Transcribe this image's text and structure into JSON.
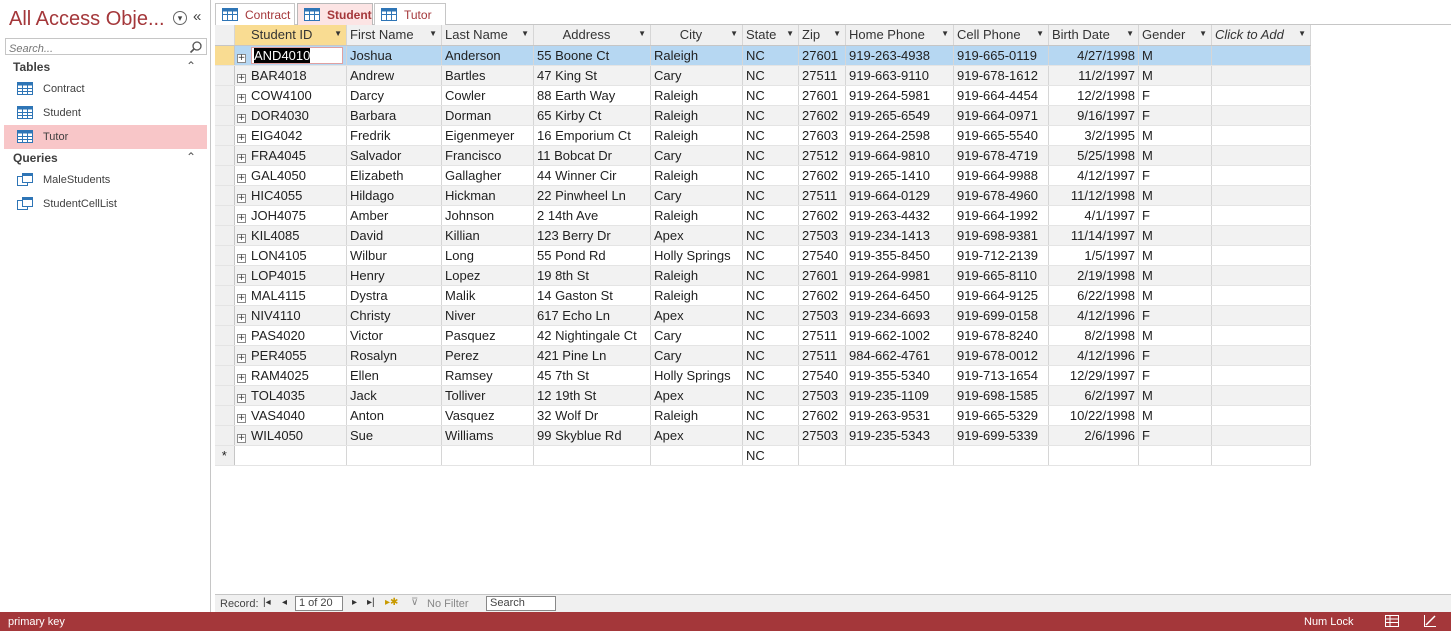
{
  "nav": {
    "title": "All Access Obje...",
    "search_placeholder": "Search...",
    "groups": [
      {
        "label": "Tables",
        "items": [
          {
            "label": "Contract",
            "icon": "table-icon"
          },
          {
            "label": "Student",
            "icon": "table-icon"
          },
          {
            "label": "Tutor",
            "icon": "table-icon",
            "selected": true
          }
        ]
      },
      {
        "label": "Queries",
        "items": [
          {
            "label": "MaleStudents",
            "icon": "query-icon"
          },
          {
            "label": "StudentCellList",
            "icon": "query-icon"
          }
        ]
      }
    ]
  },
  "tabs": [
    {
      "label": "Contract",
      "active": false
    },
    {
      "label": "Student",
      "active": true
    },
    {
      "label": "Tutor",
      "active": false
    }
  ],
  "table": {
    "columns": [
      "Student ID",
      "First Name",
      "Last Name",
      "Address",
      "City",
      "State",
      "Zip",
      "Home Phone",
      "Cell Phone",
      "Birth Date",
      "Gender",
      "Click to Add"
    ],
    "rows": [
      [
        "AND4010",
        "Joshua",
        "Anderson",
        "55 Boone Ct",
        "Raleigh",
        "NC",
        "27601",
        "919-263-4938",
        "919-665-0119",
        "4/27/1998",
        "M"
      ],
      [
        "BAR4018",
        "Andrew",
        "Bartles",
        "47 King St",
        "Cary",
        "NC",
        "27511",
        "919-663-9110",
        "919-678-1612",
        "11/2/1997",
        "M"
      ],
      [
        "COW4100",
        "Darcy",
        "Cowler",
        "88 Earth Way",
        "Raleigh",
        "NC",
        "27601",
        "919-264-5981",
        "919-664-4454",
        "12/2/1998",
        "F"
      ],
      [
        "DOR4030",
        "Barbara",
        "Dorman",
        "65 Kirby Ct",
        "Raleigh",
        "NC",
        "27602",
        "919-265-6549",
        "919-664-0971",
        "9/16/1997",
        "F"
      ],
      [
        "EIG4042",
        "Fredrik",
        "Eigenmeyer",
        "16 Emporium Ct",
        "Raleigh",
        "NC",
        "27603",
        "919-264-2598",
        "919-665-5540",
        "3/2/1995",
        "M"
      ],
      [
        "FRA4045",
        "Salvador",
        "Francisco",
        "11 Bobcat Dr",
        "Cary",
        "NC",
        "27512",
        "919-664-9810",
        "919-678-4719",
        "5/25/1998",
        "M"
      ],
      [
        "GAL4050",
        "Elizabeth",
        "Gallagher",
        "44 Winner Cir",
        "Raleigh",
        "NC",
        "27602",
        "919-265-1410",
        "919-664-9988",
        "4/12/1997",
        "F"
      ],
      [
        "HIC4055",
        "Hildago",
        "Hickman",
        "22 Pinwheel Ln",
        "Cary",
        "NC",
        "27511",
        "919-664-0129",
        "919-678-4960",
        "11/12/1998",
        "M"
      ],
      [
        "JOH4075",
        "Amber",
        "Johnson",
        "2 14th Ave",
        "Raleigh",
        "NC",
        "27602",
        "919-263-4432",
        "919-664-1992",
        "4/1/1997",
        "F"
      ],
      [
        "KIL4085",
        "David",
        "Killian",
        "123 Berry Dr",
        "Apex",
        "NC",
        "27503",
        "919-234-1413",
        "919-698-9381",
        "11/14/1997",
        "M"
      ],
      [
        "LON4105",
        "Wilbur",
        "Long",
        "55 Pond Rd",
        "Holly Springs",
        "NC",
        "27540",
        "919-355-8450",
        "919-712-2139",
        "1/5/1997",
        "M"
      ],
      [
        "LOP4015",
        "Henry",
        "Lopez",
        "19 8th St",
        "Raleigh",
        "NC",
        "27601",
        "919-264-9981",
        "919-665-8110",
        "2/19/1998",
        "M"
      ],
      [
        "MAL4115",
        "Dystra",
        "Malik",
        "14 Gaston St",
        "Raleigh",
        "NC",
        "27602",
        "919-264-6450",
        "919-664-9125",
        "6/22/1998",
        "M"
      ],
      [
        "NIV4110",
        "Christy",
        "Niver",
        "617 Echo Ln",
        "Apex",
        "NC",
        "27503",
        "919-234-6693",
        "919-699-0158",
        "4/12/1996",
        "F"
      ],
      [
        "PAS4020",
        "Victor",
        "Pasquez",
        "42 Nightingale Ct",
        "Cary",
        "NC",
        "27511",
        "919-662-1002",
        "919-678-8240",
        "8/2/1998",
        "M"
      ],
      [
        "PER4055",
        "Rosalyn",
        "Perez",
        "421 Pine Ln",
        "Cary",
        "NC",
        "27511",
        "984-662-4761",
        "919-678-0012",
        "4/12/1996",
        "F"
      ],
      [
        "RAM4025",
        "Ellen",
        "Ramsey",
        "45 7th St",
        "Holly Springs",
        "NC",
        "27540",
        "919-355-5340",
        "919-713-1654",
        "12/29/1997",
        "F"
      ],
      [
        "TOL4035",
        "Jack",
        "Tolliver",
        "12 19th St",
        "Apex",
        "NC",
        "27503",
        "919-235-1109",
        "919-698-1585",
        "6/2/1997",
        "M"
      ],
      [
        "VAS4040",
        "Anton",
        "Vasquez",
        "32 Wolf Dr",
        "Raleigh",
        "NC",
        "27602",
        "919-263-9531",
        "919-665-5329",
        "10/22/1998",
        "M"
      ],
      [
        "WIL4050",
        "Sue",
        "Williams",
        "99 Skyblue Rd",
        "Apex",
        "NC",
        "27503",
        "919-235-5343",
        "919-699-5339",
        "2/6/1996",
        "F"
      ]
    ],
    "new_row_marker": "*",
    "new_row_default_state": "NC"
  },
  "record_nav": {
    "label": "Record:",
    "position": "1 of 20",
    "filter_label": "No Filter",
    "search_label": "Search"
  },
  "status": {
    "message": "primary key",
    "num_lock": "Num Lock"
  },
  "colors": {
    "accent": "#a4373a",
    "header_highlight": "#f9dc92",
    "row_selected": "#b6d7f2",
    "nav_selected": "#f8c6c8"
  }
}
